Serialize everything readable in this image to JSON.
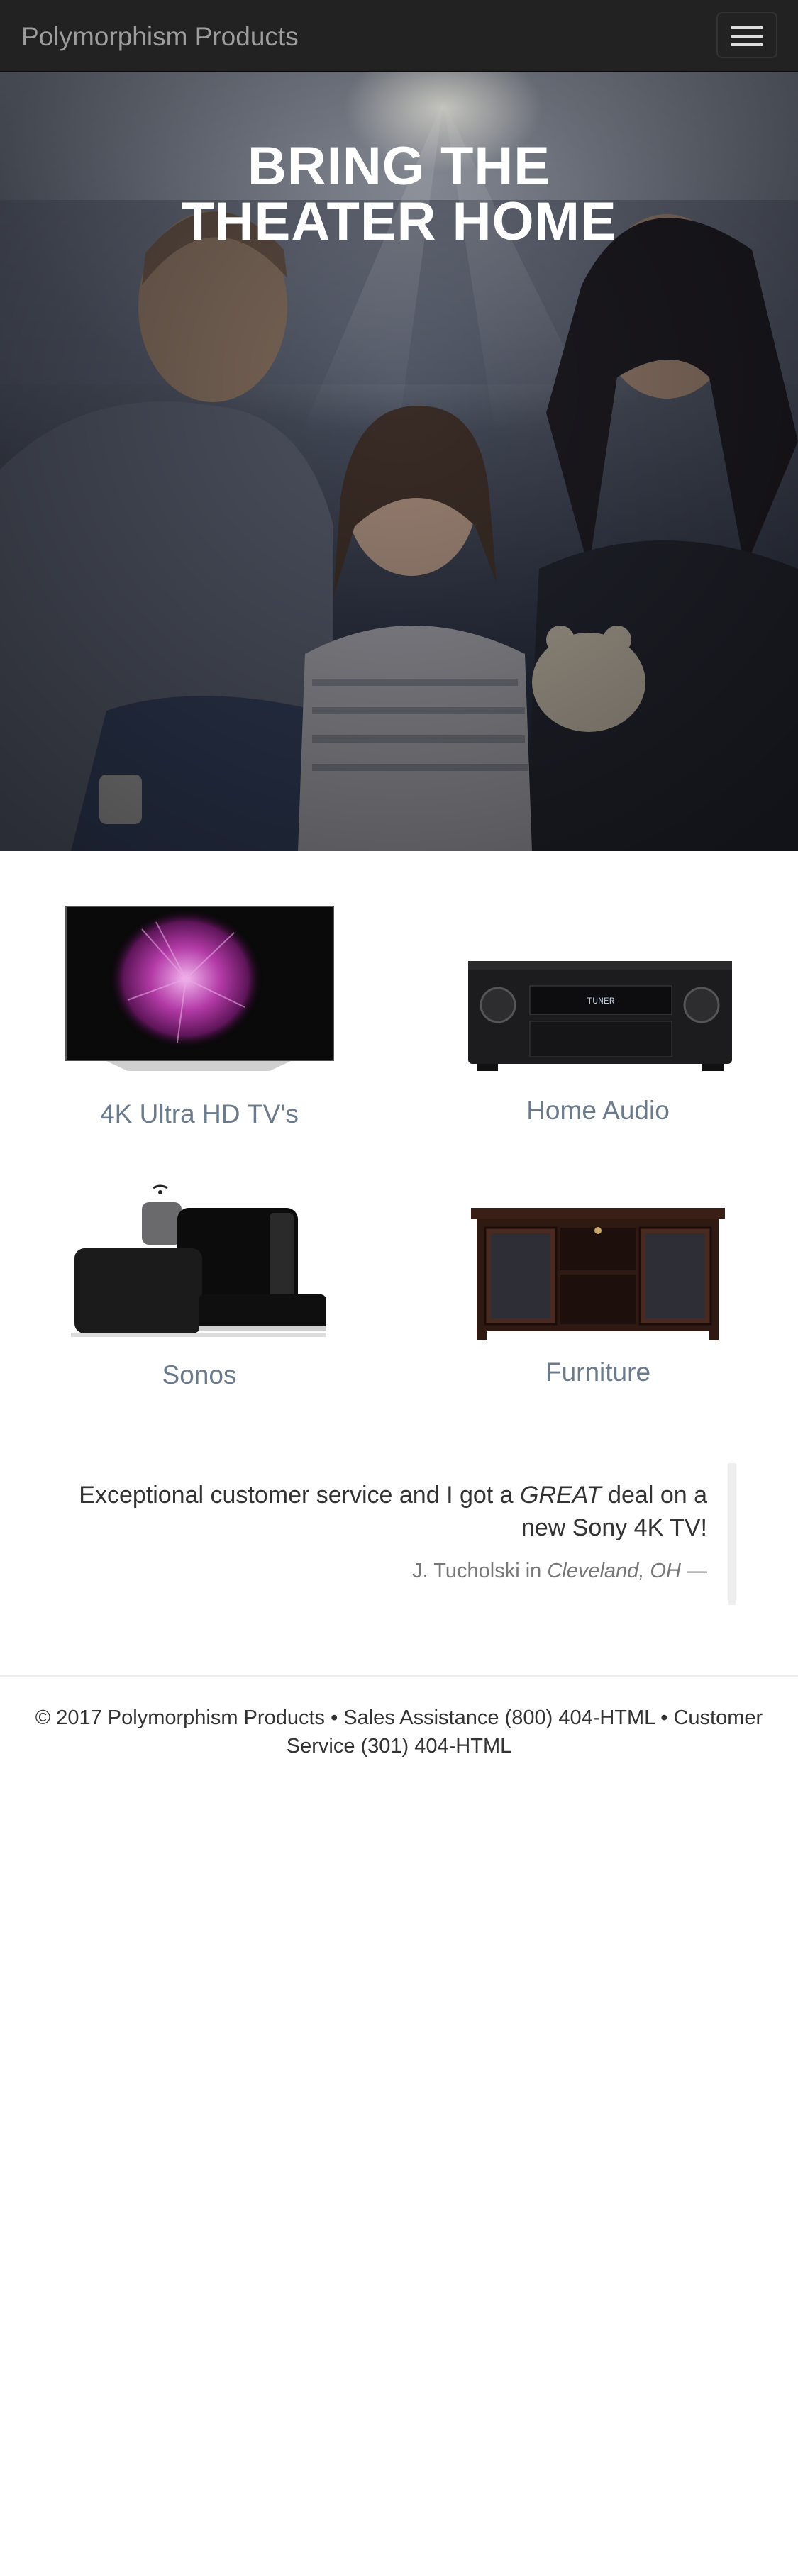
{
  "navbar": {
    "brand": "Polymorphism Products",
    "toggle_icon": "hamburger-menu-icon"
  },
  "hero": {
    "title_line1": "BRING THE",
    "title_line2": "THEATER HOME"
  },
  "products": [
    {
      "label": "4K Ultra HD TV's",
      "image": "tv-image"
    },
    {
      "label": "Home Audio",
      "image": "av-receiver-image"
    },
    {
      "label": "Sonos",
      "image": "sonos-speakers-image"
    },
    {
      "label": "Furniture",
      "image": "tv-stand-image"
    }
  ],
  "testimonial": {
    "text_before": "Exceptional customer service and I got a ",
    "text_emphasis": "GREAT",
    "text_after": " deal on a new Sony 4K TV!",
    "author": "J. Tucholski",
    "in_word": " in ",
    "location": "Cleveland, OH",
    "dash": " —"
  },
  "footer": {
    "text": "© 2017 Polymorphism Products • Sales Assistance (800) 404-HTML • Customer Service (301) 404-HTML"
  },
  "colors": {
    "navbar_bg": "#222222",
    "brand_text": "#9d9d9d",
    "product_label": "#6b7b8c",
    "quote_border": "#eeeeee"
  }
}
